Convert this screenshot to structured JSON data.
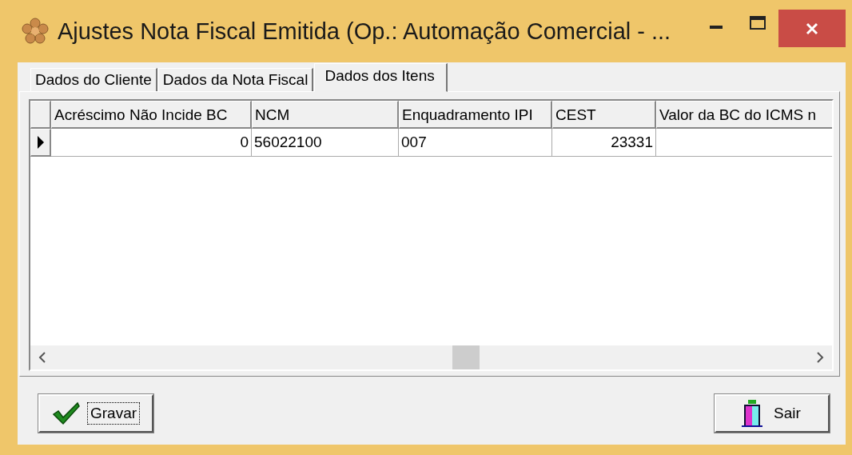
{
  "window": {
    "title": "Ajustes Nota Fiscal Emitida (Op.: Automação Comercial - ...",
    "controls": [
      {
        "kind": "minimize"
      },
      {
        "kind": "maximize"
      },
      {
        "kind": "close"
      }
    ]
  },
  "tabs": [
    {
      "label": "Dados do Cliente",
      "selected": false
    },
    {
      "label": "Dados da Nota Fiscal",
      "selected": false
    },
    {
      "label": "Dados dos Itens",
      "selected": true
    }
  ],
  "table": {
    "columns": [
      {
        "label": "Acréscimo Não Incide BC",
        "kind": "numeric"
      },
      {
        "label": "NCM",
        "kind": "text"
      },
      {
        "label": "Enquadramento IPI",
        "kind": "text"
      },
      {
        "label": "CEST",
        "kind": "numeric"
      },
      {
        "label": "Valor da BC do ICMS n",
        "kind": "text"
      }
    ],
    "rows": [
      {
        "current": true,
        "cells": [
          "0",
          "56022100",
          "007",
          "23331",
          ""
        ]
      }
    ]
  },
  "buttons": [
    {
      "label": "Gravar",
      "kind": "save",
      "focused": true
    },
    {
      "label": "Sair",
      "kind": "exit",
      "focused": false
    }
  ]
}
